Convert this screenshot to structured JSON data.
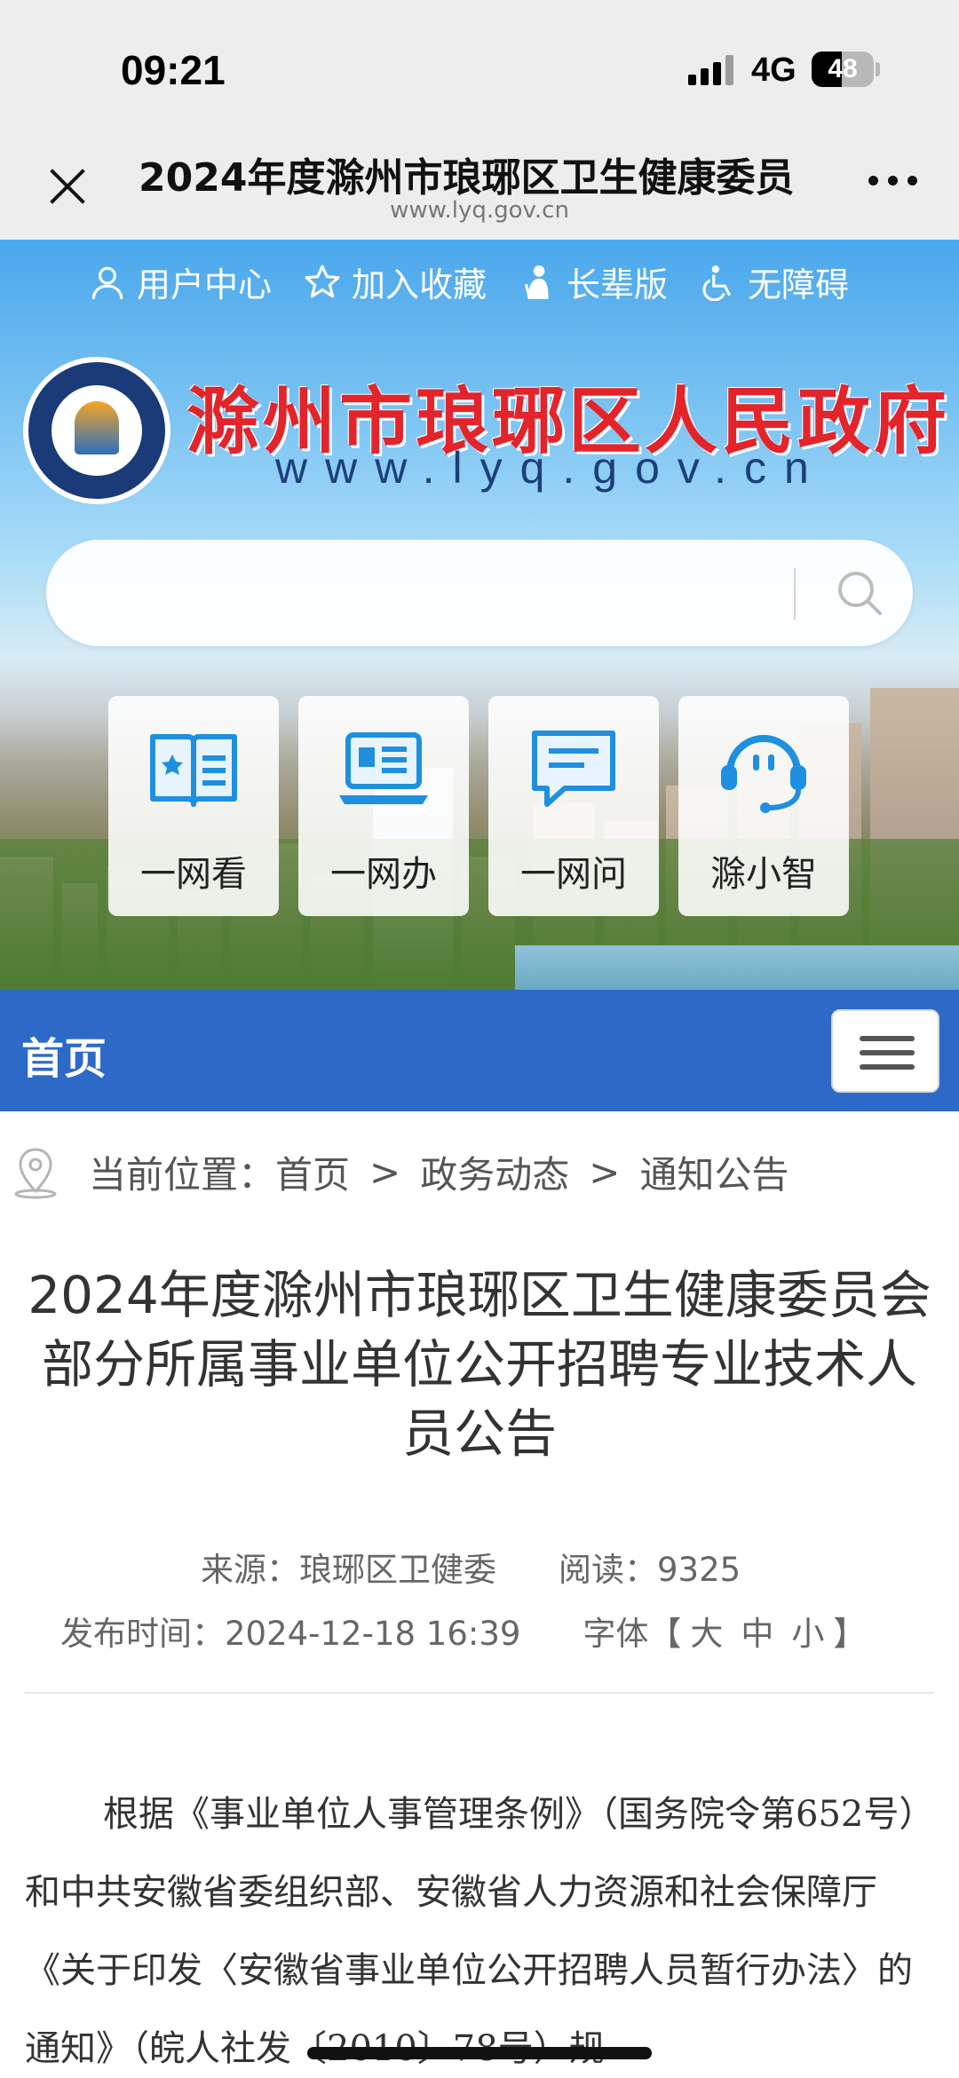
{
  "status_bar": {
    "time": "09:21",
    "network": "4G",
    "battery": "48",
    "battery_level": 0.48
  },
  "browser": {
    "title": "2024年度滁州市琅琊区卫生健康委员",
    "url": "www.lyq.gov.cn"
  },
  "header": {
    "links": [
      {
        "label": "用户中心",
        "icon": "user-icon"
      },
      {
        "label": "加入收藏",
        "icon": "star-icon"
      },
      {
        "label": "长辈版",
        "icon": "elder-icon"
      },
      {
        "label": "无障碍",
        "icon": "accessibility-icon"
      }
    ],
    "site_title": "滁州市琅琊区人民政府",
    "site_domain": "www.lyq.gov.cn",
    "search": {
      "placeholder": ""
    },
    "quick_links": [
      {
        "label": "一网看",
        "icon": "book-star-icon"
      },
      {
        "label": "一网办",
        "icon": "laptop-icon"
      },
      {
        "label": "一网问",
        "icon": "chat-bubble-icon"
      },
      {
        "label": "滁小智",
        "icon": "headset-robot-icon"
      }
    ]
  },
  "nav": {
    "home": "首页"
  },
  "breadcrumb": {
    "prefix": "当前位置：",
    "items": [
      "首页",
      "政务动态",
      "通知公告"
    ],
    "separator": ">"
  },
  "article": {
    "title": "2024年度滁州市琅琊区卫生健康委员会部分所属事业单位公开招聘专业技术人员公告",
    "source_label": "来源：",
    "source": "琅琊区卫健委",
    "reads_label": "阅读：",
    "reads": "9325",
    "date_label": "发布时间：",
    "date": "2024-12-18 16:39",
    "font_label": "字体【",
    "font_sizes": [
      "大",
      "中",
      "小"
    ],
    "font_close": "】",
    "body": "根据《事业单位人事管理条例》（国务院令第652号）和中共安徽省委组织部、安徽省人力资源和社会保障厅《关于印发〈安徽省事业单位公开招聘人员暂行办法〉的通知》（皖人社发〔2010〕78号）规"
  },
  "colors": {
    "nav_blue": "#2d6ac8",
    "title_red": "#e3242b",
    "icon_blue": "#1f8fe0"
  }
}
